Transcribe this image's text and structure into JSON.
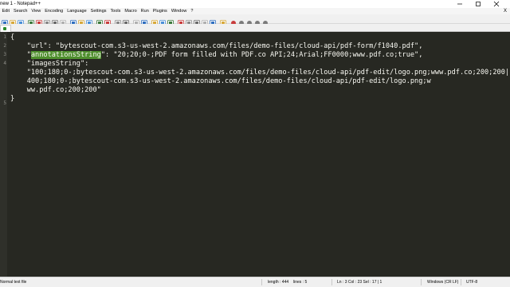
{
  "window": {
    "title": "new 1 - Notepad++"
  },
  "menu": {
    "items": [
      "Edit",
      "Search",
      "View",
      "Encoding",
      "Language",
      "Settings",
      "Tools",
      "Macro",
      "Run",
      "Plugins",
      "Window",
      "?"
    ],
    "close_x": "X"
  },
  "toolbar": {
    "icons": [
      "new-icon",
      "open-icon",
      "save-icon",
      "save-all-icon",
      "close-icon",
      "close-all-icon",
      "print-icon",
      "cut-icon",
      "copy-icon",
      "paste-icon",
      "undo-icon",
      "redo-icon",
      "find-icon",
      "replace-icon",
      "zoom-in-icon",
      "zoom-out-icon",
      "sync-v-icon",
      "sync-h-icon",
      "word-wrap-icon",
      "show-all-chars-icon",
      "indent-guide-icon",
      "lang-define-icon",
      "doc-map-icon",
      "function-list-icon",
      "folder-workspace-icon",
      "monitor-icon",
      "record-macro-icon",
      "stop-record-icon",
      "play-macro-icon",
      "play-multiple-icon",
      "save-macro-icon"
    ]
  },
  "editor": {
    "line_numbers": [
      "1",
      "2",
      "3",
      "4",
      "5"
    ],
    "lines": [
      {
        "pre": "{",
        "hl": "",
        "post": ""
      },
      {
        "pre": "    \"url\": \"bytescout-com.s3-us-west-2.amazonaws.com/files/demo-files/cloud-api/pdf-form/f1040.pdf\",",
        "hl": "",
        "post": ""
      },
      {
        "pre": "    \"",
        "hl": "annotationsString",
        "post": "\": \"20;20;0-;PDF form filled with PDF.co API;24;Arial;FF0000;www.pdf.co;true\","
      },
      {
        "pre": "    \"imagesString\":",
        "hl": "",
        "post": ""
      },
      {
        "pre": "    \"100;180;0-;bytescout-com.s3-us-west-2.amazonaws.com/files/demo-files/cloud-api/pdf-edit/logo.png;www.pdf.co;200;200|",
        "hl": "",
        "post": ""
      },
      {
        "pre": "    400;180;0-;bytescout-com.s3-us-west-2.amazonaws.com/files/demo-files/cloud-api/pdf-edit/logo.png;w",
        "hl": "",
        "post": ""
      },
      {
        "pre": "    ww.pdf.co;200;200\"",
        "hl": "",
        "post": ""
      },
      {
        "pre": "}",
        "hl": "",
        "post": ""
      }
    ]
  },
  "status": {
    "file_type": "Normal text file",
    "length": "length : 444",
    "lines": "lines : 5",
    "position": "Ln : 3    Col : 23    Sel : 17 | 1",
    "eol": "Windows (CR LF)",
    "encoding": "UTF-8"
  },
  "colors": {
    "editor_bg": "#272822",
    "string": "#e6db74",
    "highlight": "#4f8f2e"
  }
}
